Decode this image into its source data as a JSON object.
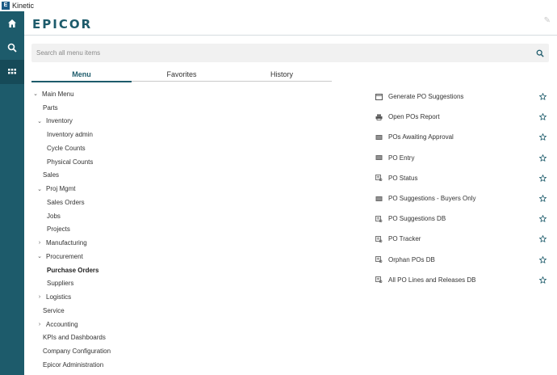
{
  "window": {
    "title": "Kinetic"
  },
  "rail": {
    "items": [
      {
        "icon": "home-icon",
        "name": "rail-home"
      },
      {
        "icon": "search-icon",
        "name": "rail-search"
      },
      {
        "icon": "apps-grid-icon",
        "name": "rail-apps"
      }
    ]
  },
  "header": {
    "logo": "EPICOR"
  },
  "search": {
    "placeholder": "Search all menu items",
    "value": ""
  },
  "tabs": [
    {
      "label": "Menu",
      "active": true
    },
    {
      "label": "Favorites",
      "active": false
    },
    {
      "label": "History",
      "active": false
    }
  ],
  "tree": [
    {
      "label": "Main Menu",
      "level": 0,
      "chevron": "expanded"
    },
    {
      "label": "Parts",
      "level": 1,
      "chevron": "none"
    },
    {
      "label": "Inventory",
      "level": 1,
      "chevron": "expanded"
    },
    {
      "label": "Inventory admin",
      "level": 2,
      "chevron": "none"
    },
    {
      "label": "Cycle Counts",
      "level": 2,
      "chevron": "none"
    },
    {
      "label": "Physical Counts",
      "level": 2,
      "chevron": "none"
    },
    {
      "label": "Sales",
      "level": 1,
      "chevron": "none"
    },
    {
      "label": "Proj Mgmt",
      "level": 1,
      "chevron": "expanded"
    },
    {
      "label": "Sales Orders",
      "level": 2,
      "chevron": "none"
    },
    {
      "label": "Jobs",
      "level": 2,
      "chevron": "none"
    },
    {
      "label": "Projects",
      "level": 2,
      "chevron": "none"
    },
    {
      "label": "Manufacturing",
      "level": 1,
      "chevron": "collapsed"
    },
    {
      "label": "Procurement",
      "level": 1,
      "chevron": "expanded"
    },
    {
      "label": "Purchase Orders",
      "level": 2,
      "chevron": "none",
      "selected": true
    },
    {
      "label": "Suppliers",
      "level": 2,
      "chevron": "none"
    },
    {
      "label": "Logistics",
      "level": 1,
      "chevron": "collapsed"
    },
    {
      "label": "Service",
      "level": 1,
      "chevron": "none"
    },
    {
      "label": "Accounting",
      "level": 1,
      "chevron": "collapsed"
    },
    {
      "label": "KPIs and Dashboards",
      "level": 1,
      "chevron": "none"
    },
    {
      "label": "Company Configuration",
      "level": 1,
      "chevron": "none"
    },
    {
      "label": "Epicor Administration",
      "level": 1,
      "chevron": "none"
    }
  ],
  "menu_items": [
    {
      "label": "Generate PO Suggestions",
      "icon": "window-icon"
    },
    {
      "label": "Open POs Report",
      "icon": "printer-icon"
    },
    {
      "label": "POs Awaiting Approval",
      "icon": "form-icon"
    },
    {
      "label": "PO Entry",
      "icon": "form-icon"
    },
    {
      "label": "PO Status",
      "icon": "tracker-icon"
    },
    {
      "label": "PO Suggestions - Buyers Only",
      "icon": "form-icon"
    },
    {
      "label": "PO Suggestions DB",
      "icon": "tracker-icon"
    },
    {
      "label": "PO Tracker",
      "icon": "tracker-icon"
    },
    {
      "label": "Orphan POs DB",
      "icon": "tracker-icon"
    },
    {
      "label": "All PO Lines and Releases DB",
      "icon": "tracker-icon"
    }
  ],
  "colors": {
    "brand": "#1d5b6b",
    "rail": "#1d5b6b",
    "search_bg": "#f1f1f1"
  }
}
